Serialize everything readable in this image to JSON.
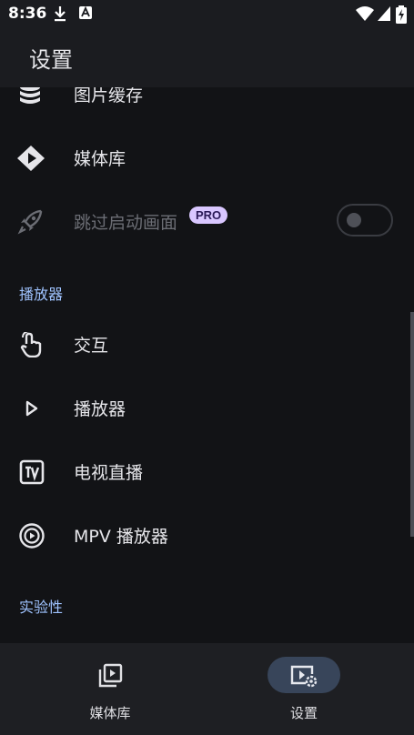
{
  "status_bar": {
    "time": "8:36"
  },
  "app_bar": {
    "title": "设置"
  },
  "rows_top": [
    {
      "label": "图片缓存",
      "icon": "database-stack-icon"
    },
    {
      "label": "媒体库",
      "icon": "jellyfin-logo-icon"
    },
    {
      "label": "跳过启动画面",
      "icon": "rocket-icon",
      "badge": "PRO",
      "toggle_on": false,
      "enabled": false
    }
  ],
  "sections": {
    "player": "播放器",
    "experimental": "实验性"
  },
  "rows_player": [
    {
      "label": "交互",
      "icon": "touch-hand-icon"
    },
    {
      "label": "播放器",
      "icon": "play-triangle-icon"
    },
    {
      "label": "电视直播",
      "icon": "tv-icon"
    },
    {
      "label": "MPV 播放器",
      "icon": "mpv-logo-icon"
    }
  ],
  "bottom_nav": [
    {
      "label": "媒体库",
      "icon": "video-library-icon",
      "active": false
    },
    {
      "label": "设置",
      "icon": "video-settings-icon",
      "active": true
    }
  ],
  "colors": {
    "background": "#121316",
    "bar": "#1b1c20",
    "accent": "#9fc3ff",
    "badge": "#d9c7ff",
    "active_pill": "#38455a"
  }
}
